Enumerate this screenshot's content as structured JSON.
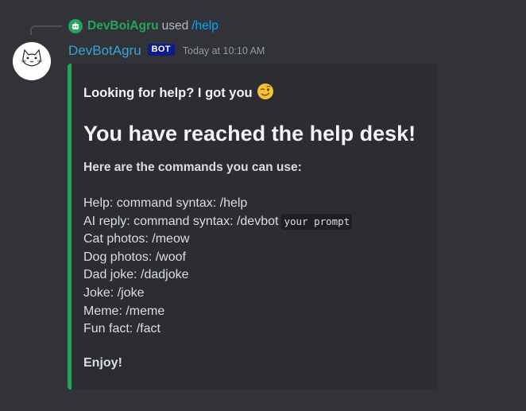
{
  "reply": {
    "user": "DevBoiAgru",
    "used_text": "used",
    "command": "/help",
    "avatar_icon": "bot-icon"
  },
  "message": {
    "username": "DevBotAgru",
    "bot_tag": "BOT",
    "timestamp": "Today at 10:10 AM",
    "avatar_icon": "cat-avatar-icon"
  },
  "embed": {
    "accent_color": "#23a55a",
    "description": "Looking for help? I got you",
    "description_emoji": "winking-face-emoji",
    "heading": "You have reached the help desk!",
    "subheading": "Here are the commands you can use:",
    "commands": [
      {
        "label": "Help: command syntax: /help",
        "code": ""
      },
      {
        "label": "AI reply: command syntax: /devbot",
        "code": "your prompt"
      },
      {
        "label": "Cat photos: /meow",
        "code": ""
      },
      {
        "label": "Dog photos: /woof",
        "code": ""
      },
      {
        "label": "Dad joke: /dadjoke",
        "code": ""
      },
      {
        "label": "Joke: /joke",
        "code": ""
      },
      {
        "label": "Meme: /meme",
        "code": ""
      },
      {
        "label": "Fun fact: /fact",
        "code": ""
      }
    ],
    "footer": "Enjoy!"
  },
  "colors": {
    "background": "#313338",
    "embed_background": "#2b2d31",
    "username": "#3aa3d7",
    "reply_user": "#23a55a",
    "link": "#00a8fc",
    "bot_tag": "#0d1b8c"
  }
}
